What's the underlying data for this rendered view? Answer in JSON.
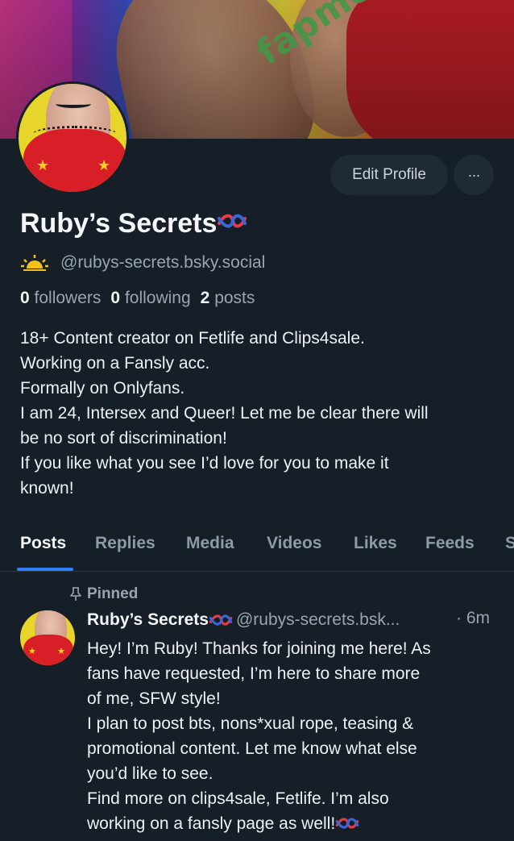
{
  "watermark": "fapmenu.com",
  "profile": {
    "display_name": "Ruby’s Secrets",
    "handle": "@rubys-secrets.bsky.social",
    "edit_label": "Edit Profile",
    "more_label": "···",
    "followers_count": "0",
    "followers_label": "followers",
    "following_count": "0",
    "following_label": "following",
    "posts_count": "2",
    "posts_label": "posts",
    "bio_lines": [
      "18+ Content creator on Fetlife and Clips4sale.",
      "Working on a Fansly acc.",
      "Formally on Onlyfans.",
      "I am 24, Intersex and Queer! Let me be clear there will",
      "be no sort of discrimination!",
      "If you like what you see I’d love for you to make it",
      "known!"
    ]
  },
  "tabs": [
    "Posts",
    "Replies",
    "Media",
    "Videos",
    "Likes",
    "Feeds",
    "S"
  ],
  "post": {
    "pinned_label": "Pinned",
    "author_name": "Ruby’s Secrets",
    "author_handle": "@rubys-secrets.bsk...",
    "time": "· 6m",
    "lines": [
      "Hey! I’m Ruby! Thanks for joining me here! As",
      "fans have requested, I’m here to share more",
      "of me, SFW style!",
      "I plan to post bts, nons*xual rope, teasing &",
      "promotional content. Let me know what else",
      "you’d like to see.",
      "Find more on clips4sale, Fetlife. I’m also",
      "working on a fansly page as well!"
    ]
  },
  "colors": {
    "background": "#161e27",
    "accent": "#2f7dfa",
    "muted": "#9aa5b1"
  }
}
